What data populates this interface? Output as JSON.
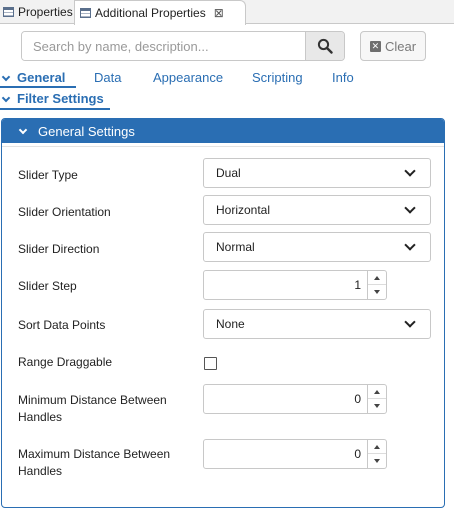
{
  "tabs": {
    "properties_label": "Properties",
    "additional_label": "Additional Properties",
    "close_glyph": "⊠"
  },
  "search": {
    "placeholder": "Search by name, description...",
    "value": "",
    "clear_label": "Clear"
  },
  "nav": {
    "general": "General",
    "data": "Data",
    "appearance": "Appearance",
    "scripting": "Scripting",
    "info": "Info",
    "sub_filter_settings": "Filter Settings"
  },
  "panel": {
    "title": "General Settings",
    "slider_type": {
      "label": "Slider Type",
      "value": "Dual"
    },
    "slider_orientation": {
      "label": "Slider Orientation",
      "value": "Horizontal"
    },
    "slider_direction": {
      "label": "Slider Direction",
      "value": "Normal"
    },
    "slider_step": {
      "label": "Slider Step",
      "value": "1"
    },
    "sort_data_points": {
      "label": "Sort Data Points",
      "value": "None"
    },
    "range_draggable": {
      "label": "Range Draggable",
      "checked": false
    },
    "min_distance": {
      "label_line1": "Minimum Distance Between",
      "label_line2": "Handles",
      "value": "0"
    },
    "max_distance": {
      "label_line1": "Maximum Distance Between",
      "label_line2": "Handles",
      "value": "0"
    }
  },
  "colors": {
    "accent": "#2a6eb3",
    "border": "#c8c8c8"
  },
  "icons": {
    "search": "search-icon",
    "clear": "clear-icon",
    "tab": "table-icon",
    "close": "close-icon",
    "chevron": "chevron-down-icon",
    "caret": "caret-down-icon",
    "spin_up": "spin-up-icon",
    "spin_down": "spin-down-icon"
  }
}
